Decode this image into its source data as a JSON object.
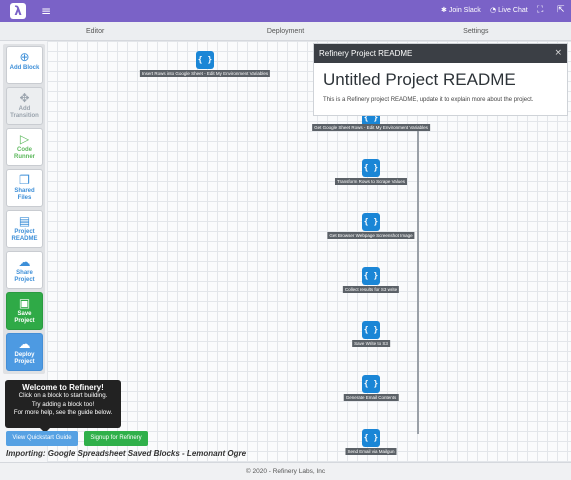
{
  "topbar": {
    "logo_glyph": "λ",
    "menu_icon": "hamburger-icon",
    "join_slack": "Join Slack",
    "live_chat": "Live Chat",
    "expand_icon": "expand-icon",
    "export_icon": "export-icon"
  },
  "tabs": [
    "Editor",
    "Deployment",
    "Settings"
  ],
  "sidebar": {
    "items": [
      {
        "label": "Add Block",
        "icon": "add-circle-icon"
      },
      {
        "label": "Add Transition",
        "icon": "move-arrows-icon"
      },
      {
        "label": "Code Runner",
        "icon": "play-icon"
      },
      {
        "label": "Shared Files",
        "icon": "files-icon"
      },
      {
        "label": "Project README",
        "icon": "book-icon"
      },
      {
        "label": "Share Project",
        "icon": "cloud-download-icon"
      },
      {
        "label": "Save Project",
        "icon": "save-icon"
      },
      {
        "label": "Deploy Project",
        "icon": "cloud-upload-icon"
      }
    ]
  },
  "canvas": {
    "block_glyph": "{ }",
    "blocks": [
      {
        "label": "Insert Rows into Google Sheet - Edit My Environment Variables"
      },
      {
        "label": "Get Google Sheet Rows - Edit My Environment Variables"
      },
      {
        "label": "Transform Rows to Scrape Values"
      },
      {
        "label": "Get Browser Webpage Screenshot Image"
      },
      {
        "label": "Collect results for S3 write"
      },
      {
        "label": "Save Write to S3"
      },
      {
        "label": "Generate Email Contents"
      },
      {
        "label": "Send Email via Mailgun"
      }
    ]
  },
  "readme": {
    "header": "Refinery Project README",
    "title": "Untitled Project README",
    "text": "This is a Refinery project README, update it to explain more about the project.",
    "close_glyph": "×"
  },
  "welcome": {
    "title": "Welcome to Refinery!",
    "line1": "Click on a block to start building.",
    "line2": "Try adding a block too!",
    "line3": "For more help, see the guide below."
  },
  "buttons": {
    "guide": "View Quickstart Guide",
    "signup": "Signup for Refinery"
  },
  "importing": "Importing: Google Spreadsheet Saved Blocks - Lemonant Ogre",
  "footer": "© 2020 - Refinery Labs, Inc",
  "colors": {
    "topbar": "#7a62c7",
    "block": "#1a86d6",
    "save": "#2faa47",
    "deploy": "#4d9ae2"
  }
}
